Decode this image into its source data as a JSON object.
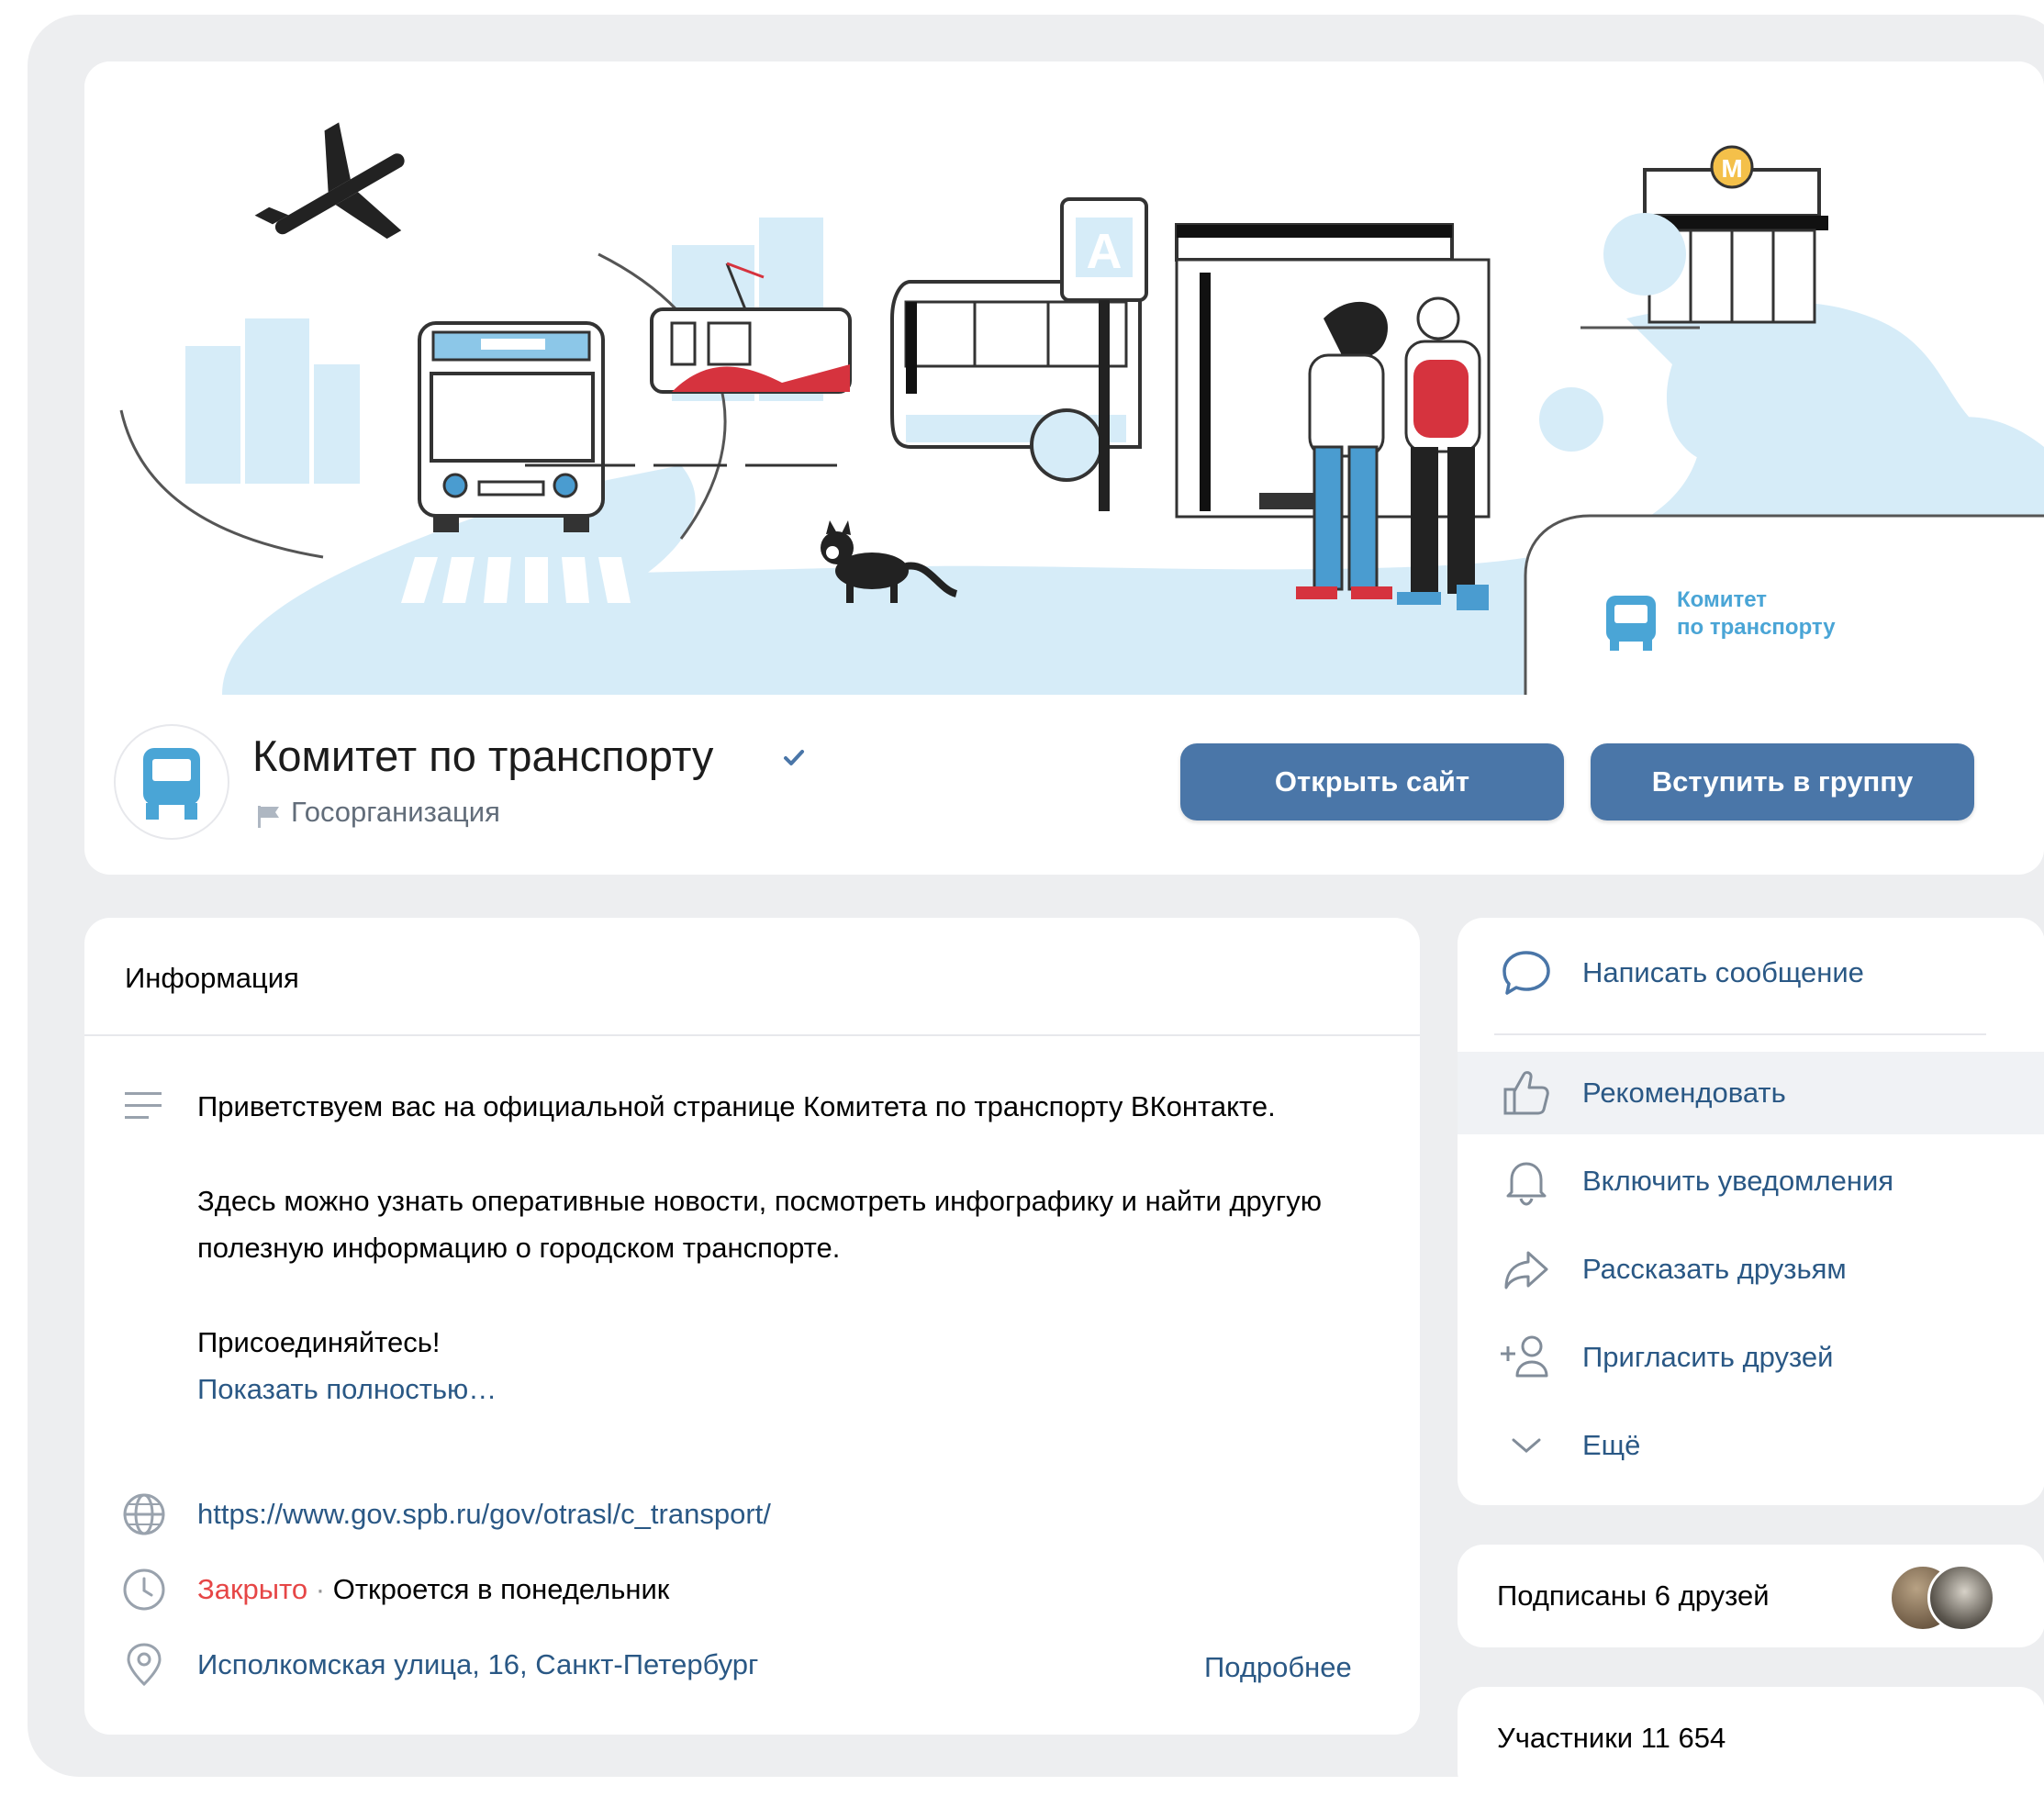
{
  "group": {
    "name": "Комитет по транспорту",
    "type": "Госорганизация",
    "cover_logo_line1": "Комитет",
    "cover_logo_line2": "по транспорту"
  },
  "buttons": {
    "open_site": "Открыть сайт",
    "join_group": "Вступить в группу"
  },
  "info": {
    "title": "Информация",
    "description": [
      "Приветствуем вас на официальной странице Комитета по транспорту ВКонтакте.",
      "Здесь можно узнать оперативные новости, посмотреть инфографику и найти другую полезную информацию о городском транспорте.",
      "Присоединяйтесь!"
    ],
    "show_more": "Показать полностью…",
    "website": "https://www.gov.spb.ru/gov/otrasl/c_transport/",
    "status_closed": "Закрыто",
    "status_separator": "·",
    "status_opens": "Откроется в понедельник",
    "address": "Исполкомская улица, 16, Санкт-Петербург",
    "more_details": "Подробнее"
  },
  "actions": [
    {
      "label": "Написать сообщение",
      "icon": "message-icon"
    },
    {
      "label": "Рекомендовать",
      "icon": "thumbs-up-icon"
    },
    {
      "label": "Включить уведомления",
      "icon": "bell-icon"
    },
    {
      "label": "Рассказать друзьям",
      "icon": "share-icon"
    },
    {
      "label": "Пригласить друзей",
      "icon": "add-user-icon"
    },
    {
      "label": "Ещё",
      "icon": "chevron-down-icon"
    }
  ],
  "friends": {
    "label": "Подписаны 6 друзей"
  },
  "members": {
    "label": "Участники 11 654"
  },
  "colors": {
    "accent": "#4a76a8",
    "link": "#2a5885",
    "closed": "#e64646",
    "cover_blue": "#d6ecf8",
    "background": "#edeef0"
  }
}
